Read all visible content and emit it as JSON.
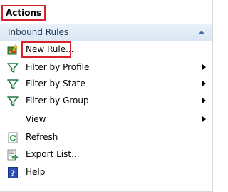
{
  "pane": {
    "title": "Actions",
    "section": {
      "label": "Inbound Rules",
      "collapse_icon": "chevron-up-icon"
    },
    "items": [
      {
        "label": "New Rule...",
        "icon": "new-rule-icon",
        "has_submenu": false
      },
      {
        "label": "Filter by Profile",
        "icon": "filter-icon",
        "has_submenu": true
      },
      {
        "label": "Filter by State",
        "icon": "filter-icon",
        "has_submenu": true
      },
      {
        "label": "Filter by Group",
        "icon": "filter-icon",
        "has_submenu": true
      },
      {
        "label": "View",
        "icon": "",
        "has_submenu": true
      },
      {
        "label": "Refresh",
        "icon": "refresh-icon",
        "has_submenu": false
      },
      {
        "label": "Export List...",
        "icon": "export-list-icon",
        "has_submenu": false
      },
      {
        "label": "Help",
        "icon": "help-icon",
        "has_submenu": false
      }
    ]
  },
  "colors": {
    "highlight_box": "#d9212b",
    "section_text": "#1e395b",
    "filter_icon": "#1e7a3c",
    "help_icon": "#2c4fb5"
  }
}
